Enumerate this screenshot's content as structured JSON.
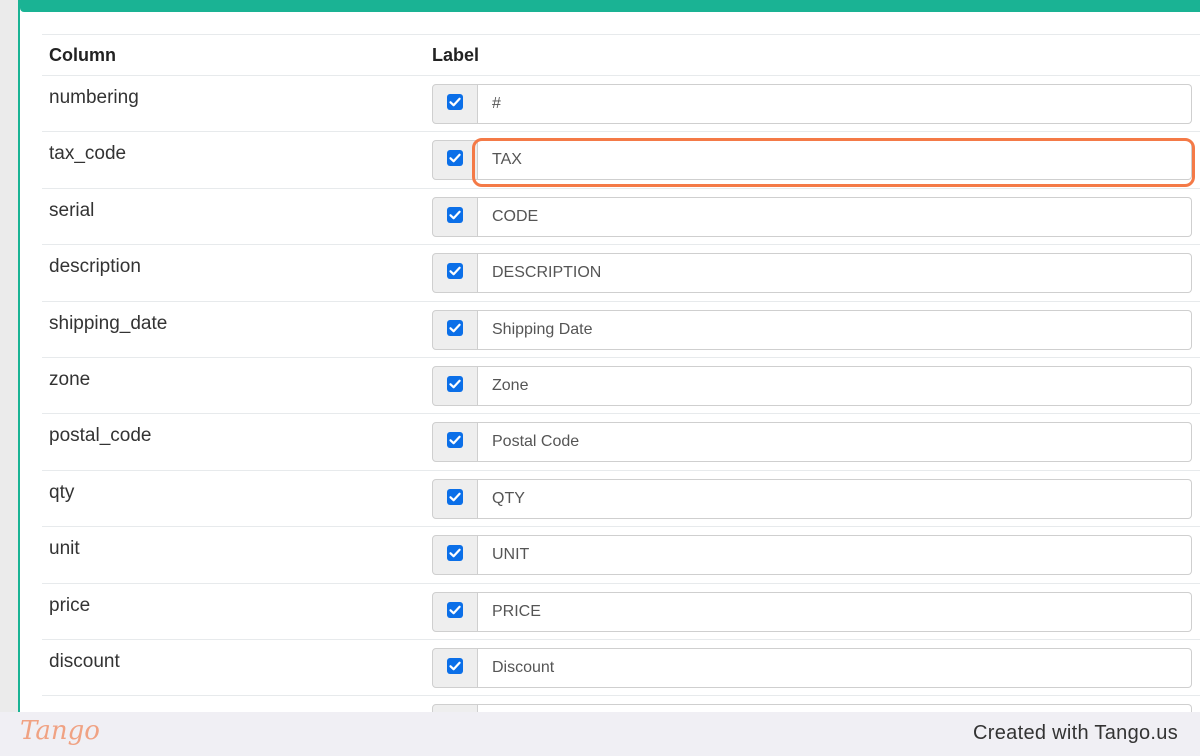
{
  "table": {
    "headers": {
      "column": "Column",
      "label": "Label"
    },
    "rows": [
      {
        "column": "numbering",
        "label": "#",
        "checked": true
      },
      {
        "column": "tax_code",
        "label": "TAX",
        "checked": true
      },
      {
        "column": "serial",
        "label": "CODE",
        "checked": true
      },
      {
        "column": "description",
        "label": "DESCRIPTION",
        "checked": true
      },
      {
        "column": "shipping_date",
        "label": "Shipping Date",
        "checked": true
      },
      {
        "column": "zone",
        "label": "Zone",
        "checked": true
      },
      {
        "column": "postal_code",
        "label": "Postal Code",
        "checked": true
      },
      {
        "column": "qty",
        "label": "QTY",
        "checked": true
      },
      {
        "column": "unit",
        "label": "UNIT",
        "checked": true
      },
      {
        "column": "price",
        "label": "PRICE",
        "checked": true
      },
      {
        "column": "discount",
        "label": "Discount",
        "checked": true
      },
      {
        "column": "",
        "label": "",
        "checked": true
      }
    ]
  },
  "highlighted_row": 1,
  "colors": {
    "accent": "#1ab394",
    "checkbox": "#0b6fe8",
    "highlight": "#f47a47"
  },
  "footer": {
    "logo_text": "Tango",
    "credit": "Created with Tango.us"
  }
}
